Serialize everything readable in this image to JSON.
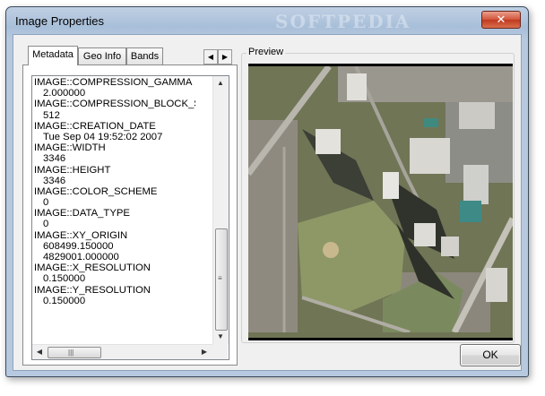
{
  "window": {
    "title": "Image Properties",
    "watermark": "SOFTPEDIA",
    "close_glyph": "✕"
  },
  "tabs": [
    {
      "label": "Metadata",
      "active": true
    },
    {
      "label": "Geo Info",
      "active": false
    },
    {
      "label": "Bands",
      "active": false
    }
  ],
  "tab_scroll": {
    "left_glyph": "◀",
    "right_glyph": "▶"
  },
  "metadata": {
    "lines": [
      "IMAGE::COMPRESSION_GAMMA",
      "2.000000",
      "IMAGE::COMPRESSION_BLOCK_SIZE",
      "512",
      "IMAGE::CREATION_DATE",
      "Tue Sep 04 19:52:02 2007",
      "IMAGE::WIDTH",
      "3346",
      "IMAGE::HEIGHT",
      "3346",
      "IMAGE::COLOR_SCHEME",
      "0",
      "IMAGE::DATA_TYPE",
      "0",
      "IMAGE::XY_ORIGIN",
      "608499.150000",
      "4829001.000000",
      "IMAGE::X_RESOLUTION",
      "0.150000",
      "IMAGE::Y_RESOLUTION",
      "0.150000"
    ],
    "scroll": {
      "up": "▲",
      "down": "▼",
      "left": "◀",
      "right": "▶",
      "grip_v": "≡",
      "grip_h": "|||"
    }
  },
  "preview": {
    "label": "Preview"
  },
  "ok_button": "OK",
  "icons": {
    "close": "close-icon",
    "tab_left": "arrow-left-icon",
    "tab_right": "arrow-right-icon"
  },
  "colors": {
    "title_bar": "#a8bfd9",
    "close_button": "#c9462b",
    "window_bg": "#f0f0f0"
  }
}
